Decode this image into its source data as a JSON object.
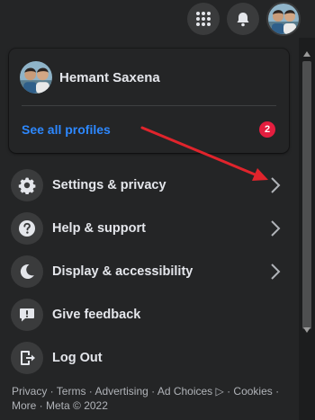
{
  "top_bar": {
    "menu_icon": "grid-menu-icon",
    "notifications_icon": "bell-icon",
    "account_icon": "profile-avatar"
  },
  "profile_card": {
    "name": "Hemant Saxena",
    "see_all_label": "See all profiles",
    "badge_count": "2"
  },
  "menu": {
    "items": [
      {
        "label": "Settings & privacy",
        "icon": "gear-icon",
        "has_chevron": true
      },
      {
        "label": "Help & support",
        "icon": "question-icon",
        "has_chevron": true
      },
      {
        "label": "Display & accessibility",
        "icon": "moon-icon",
        "has_chevron": true
      },
      {
        "label": "Give feedback",
        "icon": "feedback-icon",
        "has_chevron": false
      },
      {
        "label": "Log Out",
        "icon": "logout-icon",
        "has_chevron": false
      }
    ]
  },
  "footer": {
    "line1": "Privacy · Terms · Advertising · Ad Choices ▷ · Cookies ·",
    "line2": "More · Meta © 2022"
  },
  "colors": {
    "background": "#18191a",
    "panel": "#242526",
    "accent_link": "#2d88ff",
    "badge": "#e41e3f",
    "annotation_arrow": "#e0242c"
  }
}
